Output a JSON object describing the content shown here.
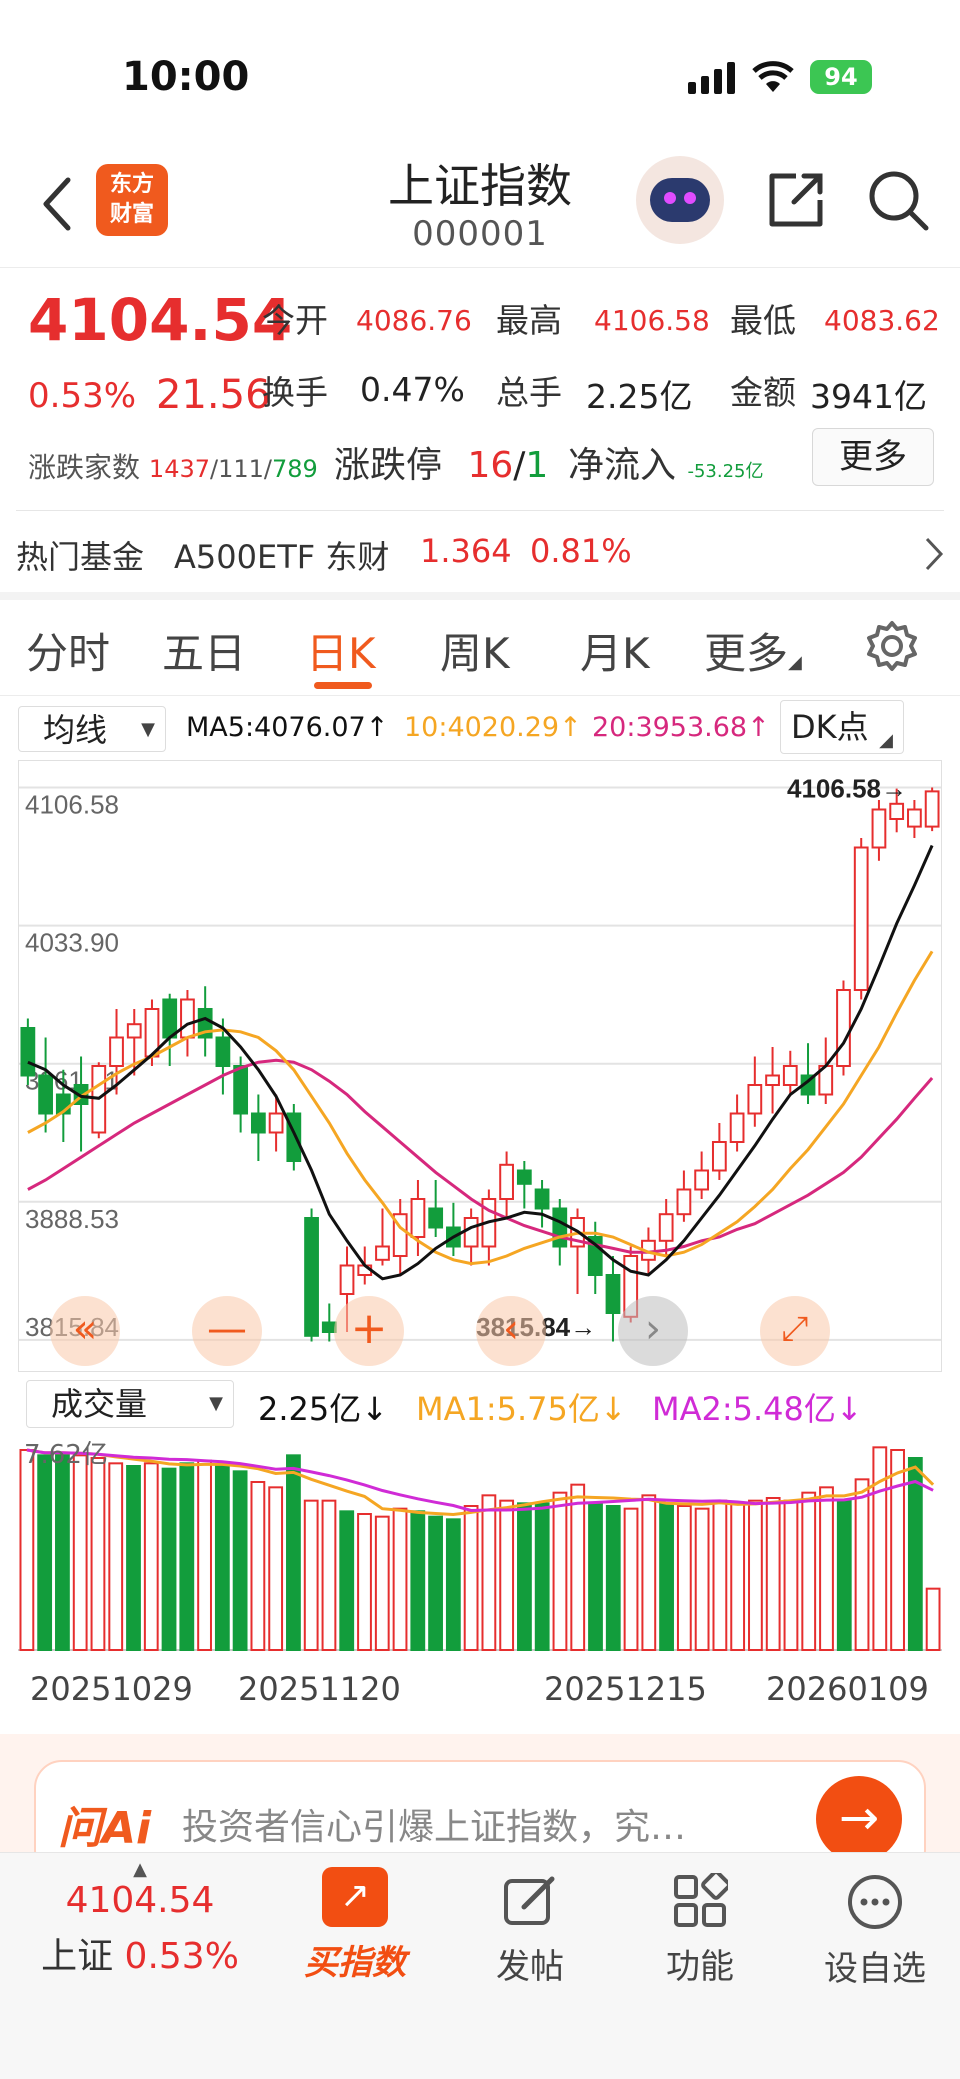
{
  "status": {
    "time": "10:00",
    "battery": "94"
  },
  "header": {
    "title": "上证指数",
    "code": "000001",
    "logo_line1": "东方",
    "logo_line2": "财富"
  },
  "quote": {
    "price": "4104.54",
    "change_pct": "0.53%",
    "change": "21.56",
    "open_label": "今开",
    "open": "4086.76",
    "high_label": "最高",
    "high": "4106.58",
    "low_label": "最低",
    "low": "4083.62",
    "turnover_label": "换手",
    "turnover": "0.47%",
    "volume_label": "总手",
    "volume": "2.25亿",
    "amount_label": "金额",
    "amount": "3941亿",
    "breadth_label": "涨跌家数",
    "up": "1437",
    "flat": "111",
    "down": "789",
    "limit_label": "涨跌停",
    "limit_up": "16",
    "limit_down": "1",
    "netflow_label": "净流入",
    "netflow": "-53.25亿",
    "more": "更多"
  },
  "hot_fund": {
    "label": "热门基金",
    "name": "A500ETF 东财",
    "price": "1.364",
    "pct": "0.81%"
  },
  "tabs": [
    "分时",
    "五日",
    "日K",
    "周K",
    "月K",
    "更多"
  ],
  "active_tab": "日K",
  "ma": {
    "selector": "均线",
    "ma5": "MA5:4076.07↑",
    "ma10": "10:4020.29↑",
    "ma20": "20:3953.68↑",
    "dk": "DK点"
  },
  "vol_ma": {
    "selector": "成交量",
    "value": "2.25亿↓",
    "ma1": "MA1:5.75亿↓",
    "ma2": "MA2:5.48亿↓",
    "axis_top": "7.62亿"
  },
  "chart_data": {
    "type": "candlestick",
    "y_ticks": [
      "4106.58",
      "4033.90",
      "3961.21",
      "3888.53",
      "3815.84"
    ],
    "high_marker": "4106.58→",
    "low_marker": "3815.84→",
    "x_labels": [
      "20251029",
      "20251120",
      "20251215",
      "20260109"
    ],
    "colors": {
      "up": "#e62e2e",
      "down": "#129d3c",
      "ma5": "#111111",
      "ma10": "#f5a623",
      "ma20": "#d6287d"
    },
    "candles": [
      [
        3980,
        3955,
        3985,
        3950
      ],
      [
        3955,
        3935,
        3975,
        3925
      ],
      [
        3945,
        3935,
        3958,
        3920
      ],
      [
        3950,
        3940,
        3965,
        3915
      ],
      [
        3925,
        3960,
        3962,
        3922
      ],
      [
        3960,
        3975,
        3990,
        3945
      ],
      [
        3975,
        3982,
        3990,
        3955
      ],
      [
        3965,
        3990,
        3995,
        3960
      ],
      [
        3995,
        3975,
        3998,
        3960
      ],
      [
        3975,
        3995,
        4000,
        3965
      ],
      [
        3990,
        3975,
        4002,
        3965
      ],
      [
        3975,
        3960,
        3985,
        3945
      ],
      [
        3960,
        3935,
        3965,
        3925
      ],
      [
        3935,
        3925,
        3945,
        3910
      ],
      [
        3925,
        3935,
        3945,
        3915
      ],
      [
        3935,
        3910,
        3940,
        3905
      ],
      [
        3880,
        3818,
        3885,
        3815
      ],
      [
        3825,
        3820,
        3835,
        3815
      ],
      [
        3840,
        3855,
        3865,
        3820
      ],
      [
        3850,
        3855,
        3865,
        3845
      ],
      [
        3858,
        3865,
        3885,
        3855
      ],
      [
        3860,
        3882,
        3890,
        3850
      ],
      [
        3870,
        3890,
        3900,
        3860
      ],
      [
        3885,
        3875,
        3900,
        3870
      ],
      [
        3875,
        3865,
        3888,
        3860
      ],
      [
        3865,
        3880,
        3885,
        3855
      ],
      [
        3865,
        3890,
        3895,
        3855
      ],
      [
        3890,
        3908,
        3915,
        3880
      ],
      [
        3905,
        3898,
        3910,
        3885
      ],
      [
        3895,
        3885,
        3900,
        3875
      ],
      [
        3885,
        3865,
        3890,
        3855
      ],
      [
        3865,
        3880,
        3885,
        3840
      ],
      [
        3870,
        3850,
        3878,
        3840
      ],
      [
        3850,
        3830,
        3860,
        3815
      ],
      [
        3828,
        3860,
        3865,
        3825
      ],
      [
        3858,
        3868,
        3875,
        3850
      ],
      [
        3868,
        3882,
        3890,
        3860
      ],
      [
        3882,
        3895,
        3905,
        3878
      ],
      [
        3895,
        3905,
        3915,
        3890
      ],
      [
        3905,
        3920,
        3930,
        3900
      ],
      [
        3920,
        3935,
        3945,
        3915
      ],
      [
        3935,
        3950,
        3965,
        3928
      ],
      [
        3950,
        3955,
        3970,
        3935
      ],
      [
        3950,
        3960,
        3968,
        3945
      ],
      [
        3955,
        3945,
        3972,
        3940
      ],
      [
        3945,
        3960,
        3975,
        3940
      ],
      [
        3960,
        4000,
        4005,
        3955
      ],
      [
        4000,
        4075,
        4080,
        3995
      ],
      [
        4075,
        4095,
        4100,
        4068
      ],
      [
        4090,
        4098,
        4106,
        4083
      ],
      [
        4086,
        4095,
        4100,
        4080
      ],
      [
        4086,
        4104.54,
        4106.58,
        4083.62
      ]
    ],
    "volumes": [
      [
        7.5,
        1
      ],
      [
        7.3,
        0
      ],
      [
        7.4,
        0
      ],
      [
        7.3,
        1
      ],
      [
        7.2,
        1
      ],
      [
        7.0,
        1
      ],
      [
        6.9,
        0
      ],
      [
        7.0,
        1
      ],
      [
        6.8,
        0
      ],
      [
        7.0,
        0
      ],
      [
        7.1,
        1
      ],
      [
        6.9,
        0
      ],
      [
        6.7,
        0
      ],
      [
        6.3,
        1
      ],
      [
        6.1,
        1
      ],
      [
        7.3,
        0
      ],
      [
        5.6,
        1
      ],
      [
        5.6,
        1
      ],
      [
        5.2,
        0
      ],
      [
        5.1,
        1
      ],
      [
        5.0,
        1
      ],
      [
        5.3,
        1
      ],
      [
        5.2,
        0
      ],
      [
        5.0,
        0
      ],
      [
        4.9,
        0
      ],
      [
        5.4,
        1
      ],
      [
        5.8,
        1
      ],
      [
        5.6,
        1
      ],
      [
        5.5,
        0
      ],
      [
        5.5,
        0
      ],
      [
        5.9,
        1
      ],
      [
        6.2,
        1
      ],
      [
        5.5,
        0
      ],
      [
        5.4,
        0
      ],
      [
        5.3,
        1
      ],
      [
        5.8,
        1
      ],
      [
        5.5,
        0
      ],
      [
        5.4,
        1
      ],
      [
        5.3,
        1
      ],
      [
        5.6,
        1
      ],
      [
        5.5,
        1
      ],
      [
        5.6,
        1
      ],
      [
        5.7,
        1
      ],
      [
        5.6,
        1
      ],
      [
        5.9,
        1
      ],
      [
        6.1,
        1
      ],
      [
        5.6,
        0
      ],
      [
        6.4,
        1
      ],
      [
        7.6,
        1
      ],
      [
        7.5,
        1
      ],
      [
        7.2,
        0
      ],
      [
        2.3,
        1
      ]
    ],
    "ma5": [
      3962,
      3958,
      3950,
      3944,
      3943,
      3950,
      3958,
      3966,
      3975,
      3982,
      3985,
      3980,
      3970,
      3958,
      3944,
      3925,
      3905,
      3882,
      3868,
      3855,
      3848,
      3850,
      3856,
      3864,
      3870,
      3875,
      3878,
      3880,
      3883,
      3882,
      3878,
      3873,
      3866,
      3858,
      3852,
      3850,
      3858,
      3868,
      3880,
      3892,
      3905,
      3918,
      3932,
      3945,
      3952,
      3960,
      3972,
      3990,
      4012,
      4035,
      4055,
      4076.07
    ],
    "ma10": [
      3925,
      3930,
      3936,
      3944,
      3950,
      3956,
      3961,
      3965,
      3970,
      3975,
      3978,
      3979,
      3978,
      3975,
      3968,
      3958,
      3944,
      3930,
      3914,
      3900,
      3888,
      3875,
      3868,
      3862,
      3858,
      3856,
      3857,
      3860,
      3864,
      3867,
      3870,
      3872,
      3872,
      3870,
      3866,
      3862,
      3860,
      3862,
      3866,
      3872,
      3878,
      3886,
      3895,
      3906,
      3916,
      3928,
      3940,
      3955,
      3970,
      3988,
      4005,
      4020.29
    ],
    "ma20": [
      3895,
      3900,
      3906,
      3912,
      3918,
      3924,
      3930,
      3935,
      3940,
      3945,
      3950,
      3955,
      3959,
      3962,
      3963,
      3962,
      3958,
      3952,
      3945,
      3936,
      3928,
      3920,
      3912,
      3904,
      3897,
      3890,
      3884,
      3880,
      3876,
      3873,
      3870,
      3868,
      3866,
      3864,
      3862,
      3862,
      3863,
      3865,
      3868,
      3870,
      3874,
      3877,
      3882,
      3887,
      3892,
      3898,
      3904,
      3912,
      3922,
      3932,
      3943,
      3953.68
    ]
  },
  "ai": {
    "logo": "问Ai",
    "prompt": "投资者信心引爆上证指数，究…"
  },
  "bottom_nav": {
    "price": "4104.54",
    "index_name": "上证",
    "pct": "0.53%",
    "buy": "买指数",
    "post": "发帖",
    "func": "功能",
    "watch": "设自选"
  }
}
